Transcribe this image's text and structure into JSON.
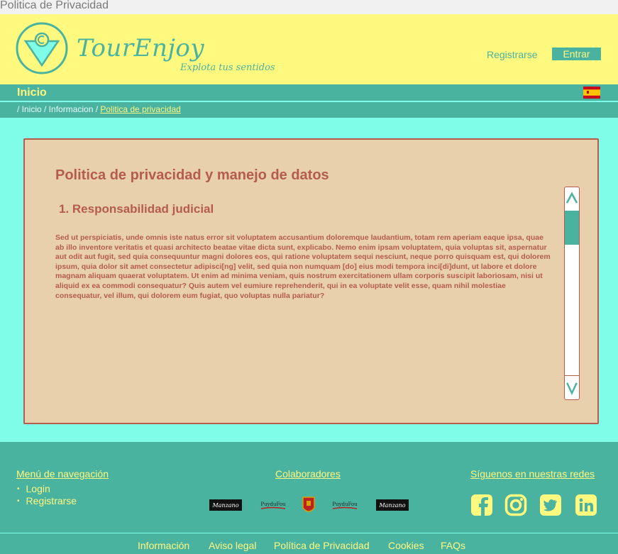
{
  "window": {
    "title": "Politica de Privacidad"
  },
  "header": {
    "brand": "TourEnjoy",
    "tagline": "Explota tus sentidos",
    "register_label": "Registrarse",
    "enter_label": "Entrar"
  },
  "nav": {
    "title": "Inicio",
    "breadcrumb": {
      "prefix": "/ Inicio / Informacion / ",
      "current": "Politica de privacidad"
    }
  },
  "content": {
    "heading": "Politica de privacidad y manejo de datos",
    "section_title": "1. Responsabilidad judicial",
    "body": "Sed ut perspiciatis, unde omnis iste natus error sit voluptatem accusantium doloremque laudantium, totam rem aperiam eaque ipsa, quae ab illo inventore veritatis et quasi architecto beatae vitae dicta sunt, explicabo. Nemo enim ipsam voluptatem, quia voluptas sit, aspernatur aut odit aut fugit, sed quia consequuntur magni dolores eos, qui ratione voluptatem sequi nesciunt, neque porro quisquam est, qui dolorem ipsum, quia dolor sit amet consectetur adipisci[ng] velit, sed quia non numquam  [do] eius modi tempora inci[di]dunt, ut labore et dolore magnam aliquam quaerat voluptatem. Ut enim ad minima veniam, quis nostrum exercitationem ullam corporis suscipit laboriosam, nisi ut aliquid ex ea commodi consequatur? Quis autem vel eumiure reprehenderit, qui in ea voluptate velit esse, quam nihil molestiae consequatur, vel illum, qui dolorem eum fugiat, quo voluptas nulla pariatur?"
  },
  "footer": {
    "nav_heading": "Menú de navegación",
    "nav_items": [
      "Login",
      "Registrarse"
    ],
    "partners_heading": "Colaboradores",
    "partners": [
      "Manzano",
      "PuyduFou",
      "escudo",
      "PuyduFou",
      "Manzano"
    ],
    "social_heading": "Síguenos en nuestras redes",
    "social_icons": [
      "facebook-icon",
      "instagram-icon",
      "twitter-icon",
      "linkedin-icon"
    ],
    "bottom_links": [
      "Información",
      "Aviso legal",
      "Política de Privacidad",
      "Cookies",
      "FAQs"
    ]
  },
  "colors": {
    "header_bg": "#fff980",
    "teal": "#4ab39f",
    "page_bg": "#7ffde9",
    "card_bg": "#e8d0ac",
    "text_accent": "#b55c4c"
  }
}
